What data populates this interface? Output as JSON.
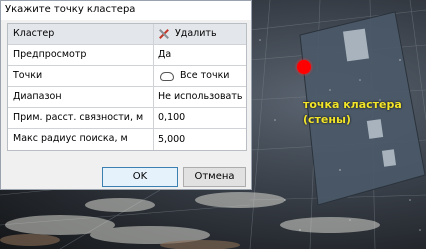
{
  "scene": {
    "annotation": "точка кластера\n(стены)",
    "annotation_line1": "точка кластера",
    "annotation_line2": "(стены)",
    "marker_color": "#ff0000",
    "annotation_color": "#f2e52a"
  },
  "dialog": {
    "title": "Укажите точку кластера",
    "rows": [
      {
        "name": "Кластер",
        "value": "Удалить",
        "icon": "delete-icon",
        "header": true
      },
      {
        "name": "Предпросмотр",
        "value": "Да"
      },
      {
        "name": "Точки",
        "value": "Все точки",
        "icon": "cloud-icon"
      },
      {
        "name": "Диапазон",
        "value": "Не использовать"
      },
      {
        "name": "Прим. расст. связности, м",
        "value": "0,100"
      },
      {
        "name": "Макс радиус поиска, м",
        "value": "5,000"
      }
    ],
    "ok_label": "OK",
    "cancel_label": "Отмена"
  }
}
